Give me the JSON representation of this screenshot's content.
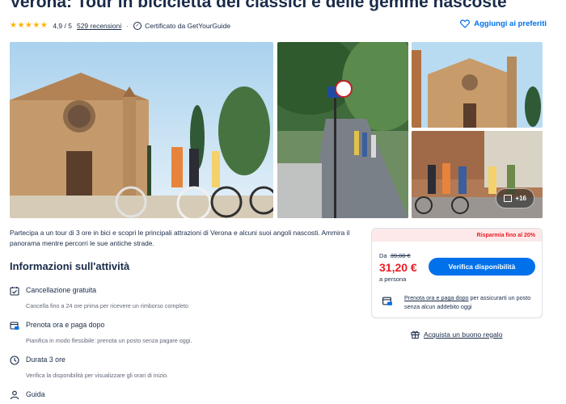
{
  "header": {
    "title": "Verona: Tour in bicicletta dei classici e delle gemme nascoste",
    "stars": "★★★★★",
    "rating": "4,9 / 5",
    "reviews": "529 recensioni",
    "separator": "·",
    "certified": "Certificato da GetYourGuide",
    "wishlist_label": "Aggiungi ai preferiti"
  },
  "gallery": {
    "more_photos_label": "+16"
  },
  "description": "Partecipa a un tour di 3 ore in bici e scopri le principali attrazioni di Verona e alcuni suoi angoli nascosti. Ammira il panorama mentre percorri le sue antiche strade.",
  "info": {
    "title": "Informazioni sull'attività",
    "items": [
      {
        "title": "Cancellazione gratuita",
        "subtitle": "Cancella fino a 24 ore prima per ricevere un rimborso completo",
        "icon": "calendar-check-icon"
      },
      {
        "title": "Prenota ora e paga dopo",
        "subtitle": "Pianifica in modo flessibile: prenota un posto senza pagare oggi.",
        "icon": "calendar-card-icon"
      },
      {
        "title": "Durata 3 ore",
        "subtitle": "Verifica la disponibilità per visualizzare gli orari di inizio.",
        "icon": "clock-icon"
      },
      {
        "title": "Guida",
        "subtitle": "",
        "icon": "person-icon"
      }
    ]
  },
  "booking": {
    "savings": "Risparmia fino al 20%",
    "from_label": "Da",
    "old_price": "39,00 €",
    "new_price": "31,20 €",
    "per_person": "a persona",
    "check_button": "Verifica disponibilità",
    "reserve_link": "Prenota ora e paga dopo",
    "reserve_text": " per assicurarti un posto senza alcun addebito oggi"
  },
  "gift": {
    "label": "Acquista un buono regalo"
  },
  "colors": {
    "brand_blue": "#0071eb",
    "price_red": "#eb1c24",
    "text_dark": "#1a2b49",
    "star": "#ffb400"
  }
}
